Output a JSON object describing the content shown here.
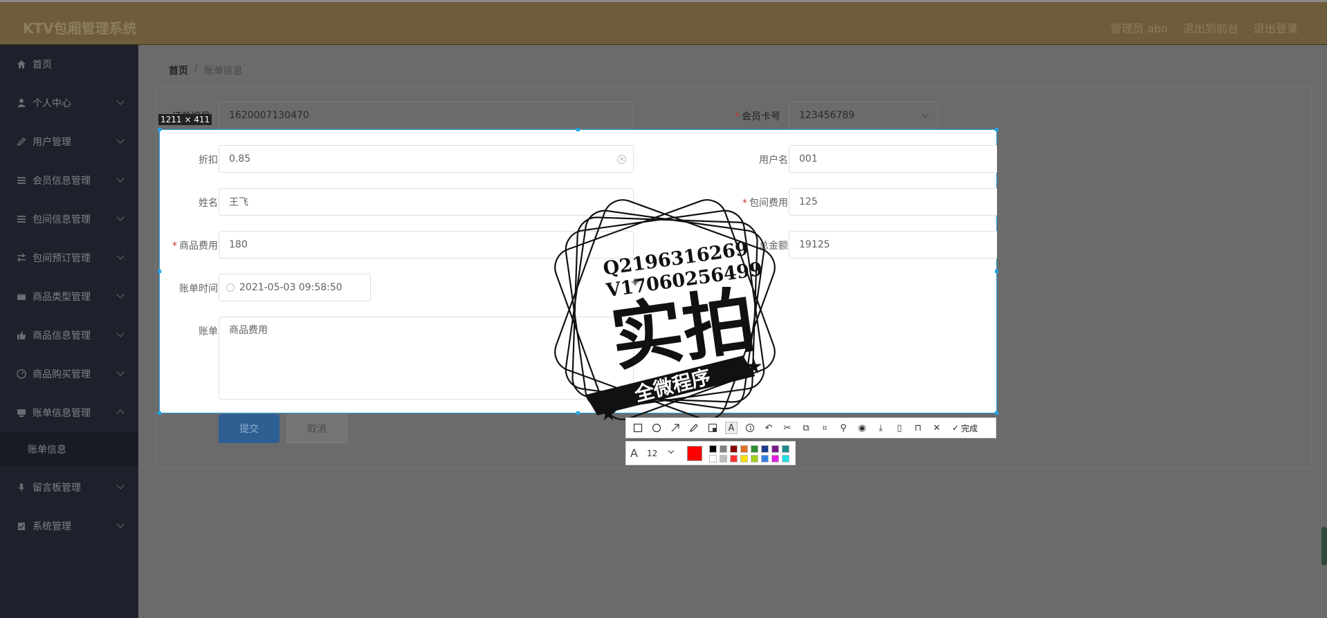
{
  "header": {
    "title": "KTV包厢管理系统",
    "admin_label": "管理员 abo",
    "back_to_front": "退出到前台",
    "logout": "退出登录"
  },
  "sidebar": {
    "items": [
      {
        "label": "首页",
        "icon": "home-icon"
      },
      {
        "label": "个人中心",
        "icon": "user-icon"
      },
      {
        "label": "用户管理",
        "icon": "edit-icon"
      },
      {
        "label": "会员信息管理",
        "icon": "list-icon"
      },
      {
        "label": "包间信息管理",
        "icon": "list-icon"
      },
      {
        "label": "包间预订管理",
        "icon": "sliders-icon"
      },
      {
        "label": "商品类型管理",
        "icon": "box-icon"
      },
      {
        "label": "商品信息管理",
        "icon": "thumb-icon"
      },
      {
        "label": "商品购买管理",
        "icon": "gauge-icon"
      },
      {
        "label": "账单信息管理",
        "icon": "monitor-icon"
      },
      {
        "label": "账单信息",
        "icon": ""
      },
      {
        "label": "留言板管理",
        "icon": "mic-icon"
      },
      {
        "label": "系统管理",
        "icon": "clipboard-icon"
      }
    ]
  },
  "breadcrumb": {
    "home": "首页",
    "separator": "/",
    "current": "账单信息"
  },
  "form": {
    "order_no_label": "订单编号",
    "order_no_value": "1620007130470",
    "card_no_label": "会员卡号",
    "card_no_value": "123456789",
    "discount_label": "折扣",
    "discount_value": "0.85",
    "username_label": "用户名",
    "username_value": "001",
    "name_label": "姓名",
    "name_value": "王飞",
    "room_fee_label": "包间费用",
    "room_fee_value": "125",
    "goods_fee_label": "商品费用",
    "goods_fee_value": "180",
    "total_label": "总金额",
    "total_value": "19125",
    "bill_time_label": "账单时间",
    "bill_time_value": "2021-05-03 09:58:50",
    "bill_label": "账单",
    "bill_value": "商品费用",
    "submit": "提交",
    "cancel": "取消"
  },
  "capture": {
    "size_label": "1211 × 411",
    "done_label": "完成",
    "font_size": "12"
  },
  "stamp": {
    "line1": "Q2196316269",
    "line2": "V17060256499",
    "big": "实拍",
    "banner": "全微程序"
  },
  "colors": {
    "header_bg": "#6e5d3a",
    "sidebar_bg": "#1d212b",
    "accent_blue": "#23a3e3",
    "submit_bg": "#2e6aa8",
    "selected_color": "#ff0000"
  }
}
